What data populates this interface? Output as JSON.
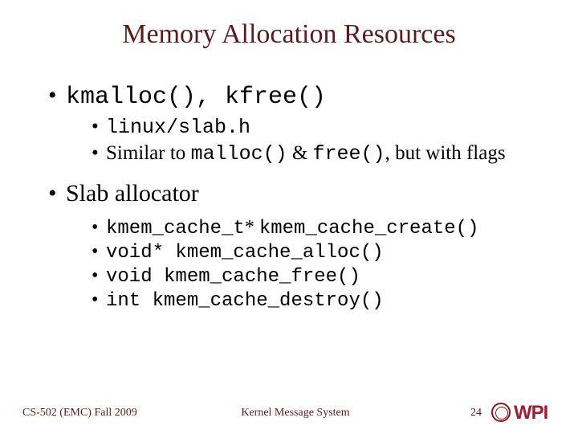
{
  "title": "Memory Allocation Resources",
  "section1": {
    "heading": "kmalloc(), kfree()",
    "sub1": "linux/slab.h",
    "sub2_pre": "Similar to ",
    "sub2_code1": "malloc()",
    "sub2_mid": " & ",
    "sub2_code2": "free()",
    "sub2_post": ", but with flags"
  },
  "section2": {
    "heading": "Slab allocator",
    "items": [
      {
        "code_pre": "kmem_cache_t",
        "plain": "* ",
        "code_post": "kmem_cache_create()"
      },
      {
        "code_pre": "void* kmem_cache_alloc()",
        "plain": "",
        "code_post": ""
      },
      {
        "code_pre": "void kmem_cache_free()",
        "plain": "",
        "code_post": ""
      },
      {
        "code_pre": "int kmem_cache_destroy()",
        "plain": "",
        "code_post": ""
      }
    ]
  },
  "footer": {
    "left": "CS-502 (EMC) Fall 2009",
    "center": "Kernel Message System",
    "page": "24",
    "logo_text": "WPI"
  }
}
